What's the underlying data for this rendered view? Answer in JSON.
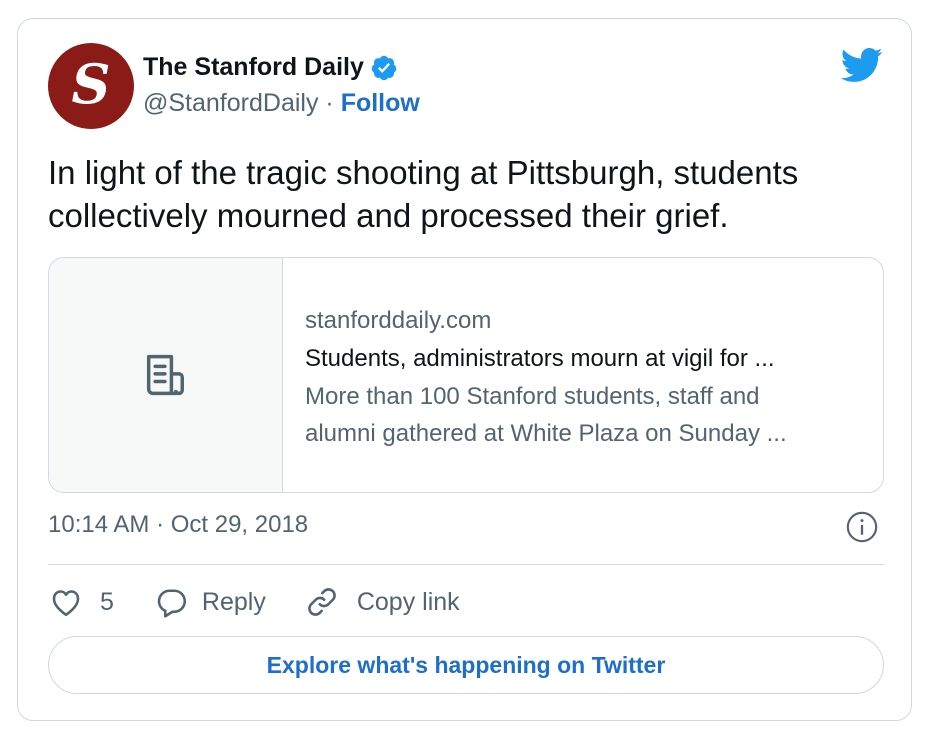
{
  "author": {
    "name": "The Stanford Daily",
    "handle": "@StanfordDaily",
    "separator": "·",
    "follow_label": "Follow",
    "avatar_letter": "S",
    "avatar_color": "#8b1b17",
    "verified": true
  },
  "tweet": {
    "text": "In light of the tragic shooting at Pittsburgh, students collectively mourned and processed their grief."
  },
  "link_card": {
    "domain": "stanforddaily.com",
    "title": "Students, administrators mourn at vigil for ...",
    "description_line1": "More than 100 Stanford students, staff and",
    "description_line2": "alumni gathered at White Plaza on Sunday ...",
    "thumbnail_icon": "document-icon"
  },
  "timestamp": "10:14 AM · Oct 29, 2018",
  "actions": {
    "like_count": "5",
    "reply_label": "Reply",
    "copy_link_label": "Copy link"
  },
  "explore_label": "Explore what's happening on Twitter",
  "colors": {
    "accent": "#1d6fc9",
    "twitter_blue": "#1d9bf0",
    "muted_text": "#536471",
    "border": "#cfd9de"
  }
}
